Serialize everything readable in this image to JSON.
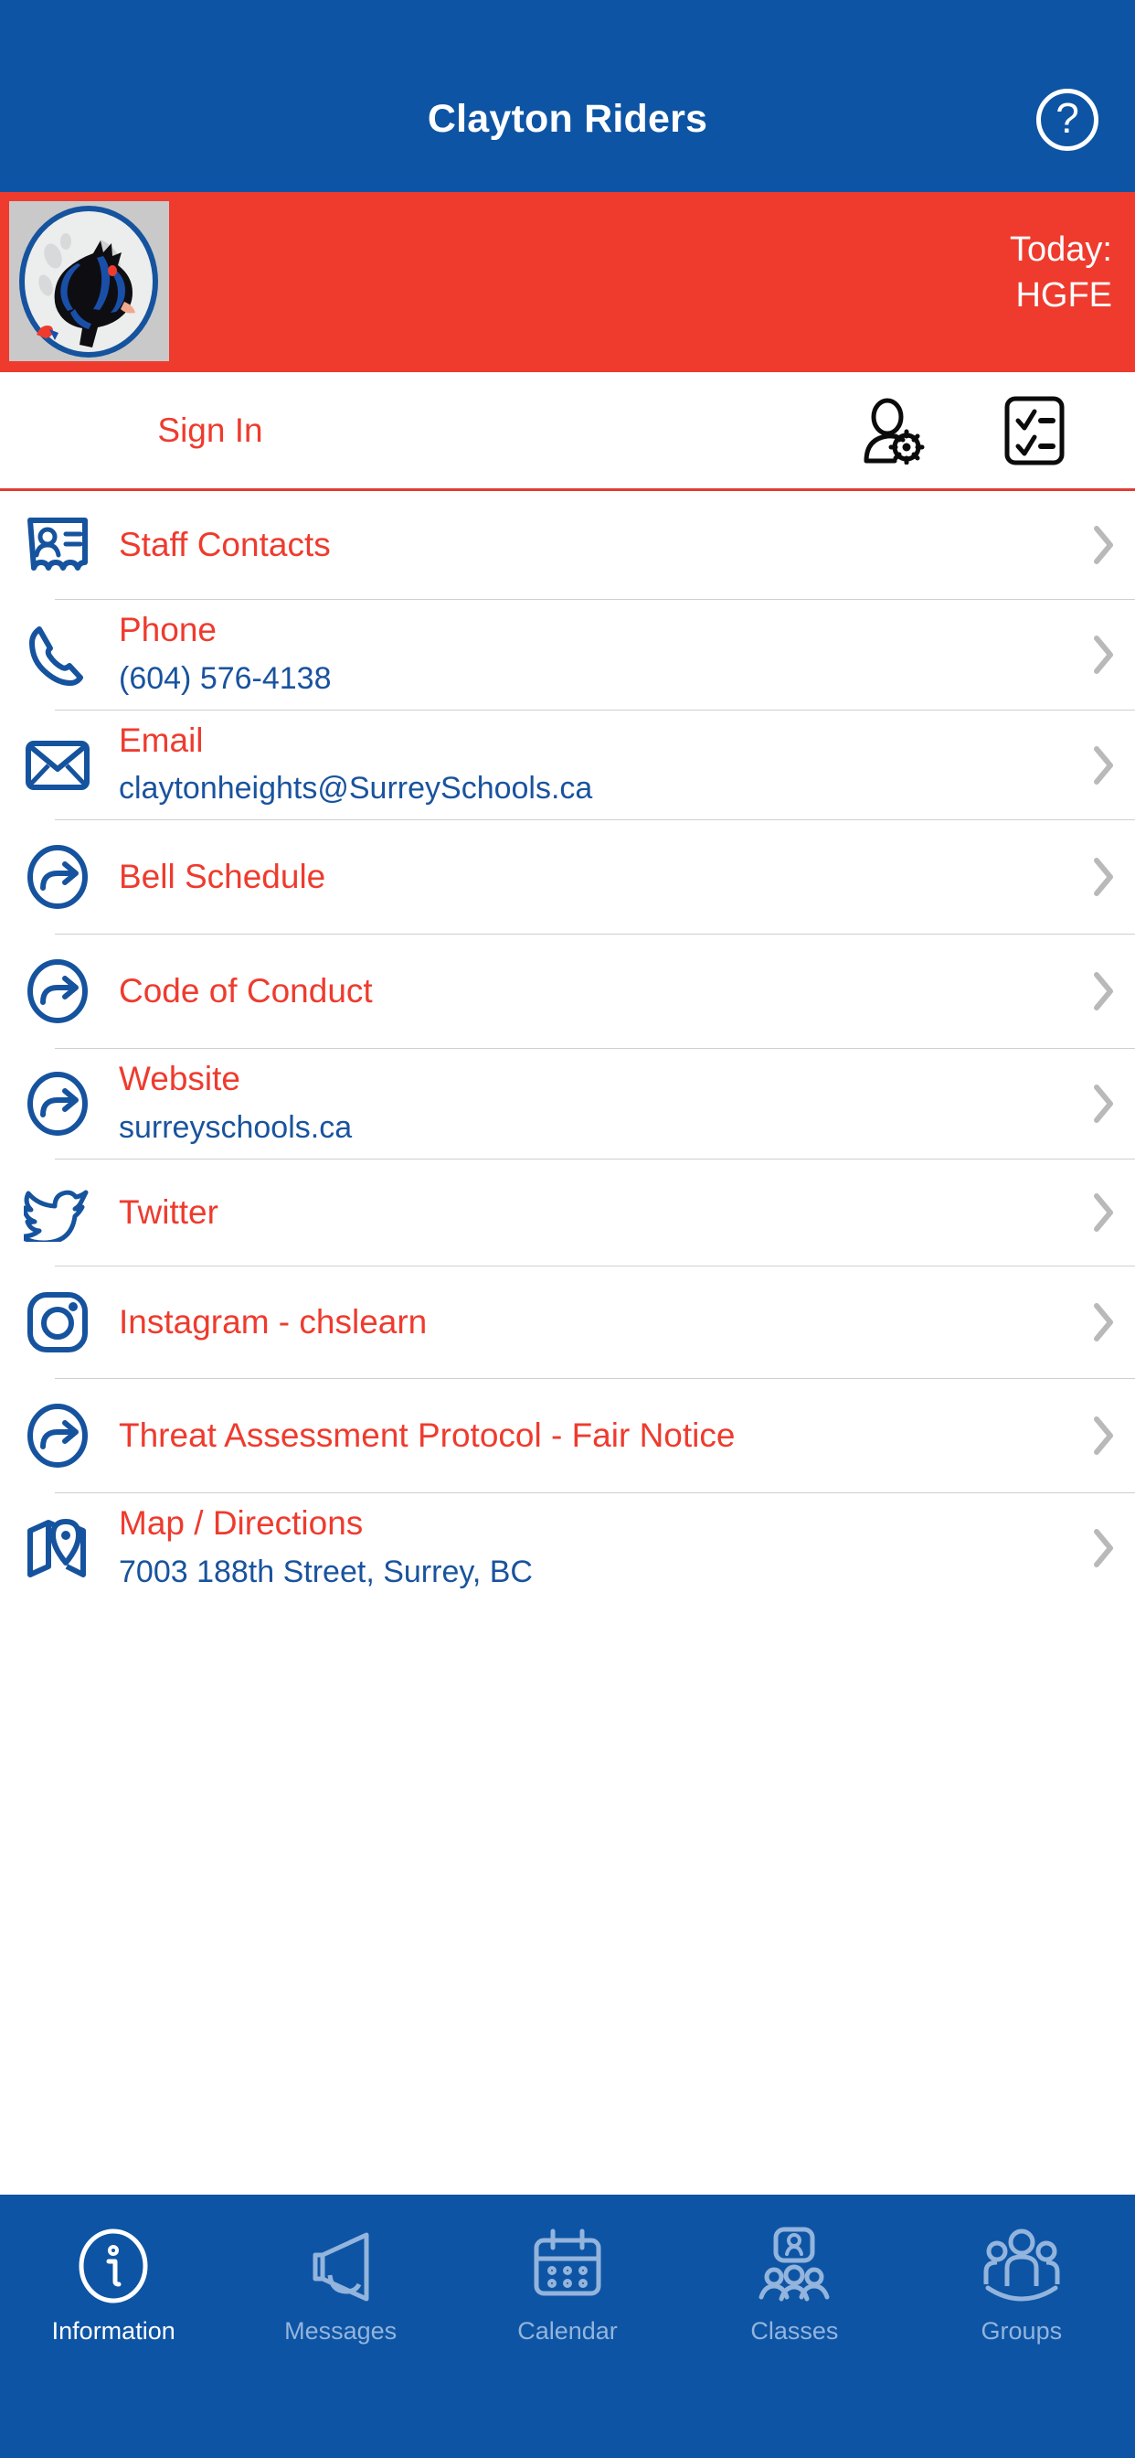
{
  "header": {
    "title": "Clayton Riders",
    "help_icon": "question-circle-icon"
  },
  "banner": {
    "logo_alt": "clayton-riders-horse-logo",
    "today_label": "Today:",
    "today_value": "HGFE",
    "background_color": "#ee3b2e"
  },
  "signin": {
    "label": "Sign In",
    "user_settings_icon": "user-settings-icon",
    "checklist_icon": "checklist-icon"
  },
  "list": [
    {
      "icon": "contact-card-icon",
      "title": "Staff Contacts",
      "sub": ""
    },
    {
      "icon": "phone-icon",
      "title": "Phone",
      "sub": "(604) 576-4138"
    },
    {
      "icon": "envelope-icon",
      "title": "Email",
      "sub": "claytonheights@SurreySchools.ca"
    },
    {
      "icon": "external-link-icon",
      "title": "Bell Schedule",
      "sub": ""
    },
    {
      "icon": "external-link-icon",
      "title": "Code of Conduct",
      "sub": ""
    },
    {
      "icon": "external-link-icon",
      "title": "Website",
      "sub": "surreyschools.ca"
    },
    {
      "icon": "twitter-icon",
      "title": "Twitter",
      "sub": ""
    },
    {
      "icon": "instagram-icon",
      "title": "Instagram - chslearn",
      "sub": ""
    },
    {
      "icon": "external-link-icon",
      "title": "Threat Assessment Protocol - Fair Notice",
      "sub": ""
    },
    {
      "icon": "map-pin-icon",
      "title": "Map / Directions",
      "sub": "7003 188th Street, Surrey, BC"
    }
  ],
  "tabs": [
    {
      "label": "Information",
      "icon": "info-circle-icon",
      "active": true
    },
    {
      "label": "Messages",
      "icon": "megaphone-icon",
      "active": false
    },
    {
      "label": "Calendar",
      "icon": "calendar-icon",
      "active": false
    },
    {
      "label": "Classes",
      "icon": "classes-icon",
      "active": false
    },
    {
      "label": "Groups",
      "icon": "groups-icon",
      "active": false
    }
  ],
  "colors": {
    "header_blue": "#0d54a4",
    "banner_red": "#ee3b2e",
    "title_red": "#ee3b2e",
    "sub_blue": "#19539e",
    "icon_blue": "#16539e",
    "tab_inactive": "#93b4dc"
  }
}
